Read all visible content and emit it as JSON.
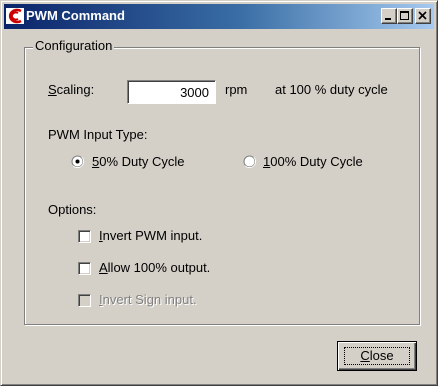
{
  "window": {
    "title": "PWM Command",
    "icon": "app-logo-icon",
    "controls": [
      "minimize-icon",
      "maximize-icon",
      "close-icon"
    ]
  },
  "configuration": {
    "group_label": "Configuration",
    "scaling": {
      "label_first": "S",
      "label_rest": "caling:",
      "value": "3000",
      "unit": "rpm",
      "note": "at 100 % duty cycle"
    },
    "pwm_input_type": {
      "label": "PWM Input Type:",
      "options": [
        {
          "underline": "5",
          "rest": "0% Duty Cycle",
          "selected": true
        },
        {
          "underline": "1",
          "rest": "00% Duty Cycle",
          "selected": false
        }
      ]
    },
    "options": {
      "label": "Options:",
      "items": [
        {
          "underline": "I",
          "rest": "nvert PWM input.",
          "checked": false,
          "enabled": true
        },
        {
          "underline": "A",
          "rest": "llow 100% output.",
          "checked": false,
          "enabled": true
        },
        {
          "underline": "I",
          "rest": "nvert Sign input.",
          "checked": false,
          "enabled": false
        }
      ]
    }
  },
  "buttons": {
    "close_first": "C",
    "close_rest": "lose"
  },
  "colors": {
    "title_start": "#0a246a",
    "title_end": "#a6caf0",
    "face": "#d4d0c8",
    "disabled_text": "#808080"
  }
}
